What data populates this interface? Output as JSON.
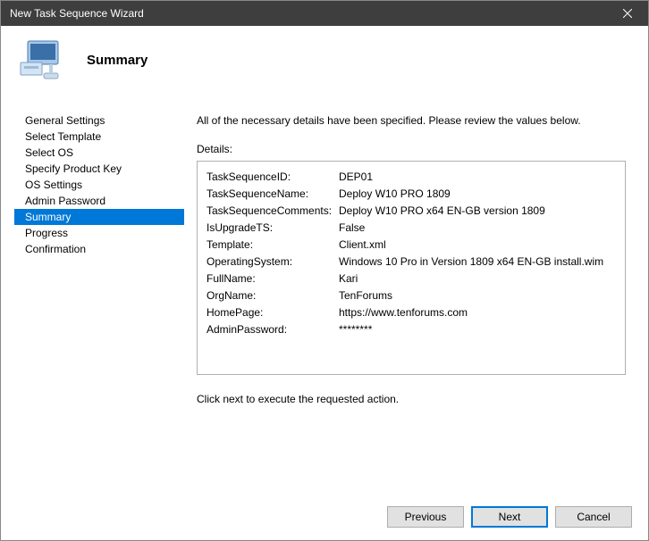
{
  "titlebar": {
    "title": "New Task Sequence Wizard"
  },
  "header": {
    "title": "Summary"
  },
  "sidebar": {
    "items": [
      {
        "label": "General Settings",
        "selected": false
      },
      {
        "label": "Select Template",
        "selected": false
      },
      {
        "label": "Select OS",
        "selected": false
      },
      {
        "label": "Specify Product Key",
        "selected": false
      },
      {
        "label": "OS Settings",
        "selected": false
      },
      {
        "label": "Admin Password",
        "selected": false
      },
      {
        "label": "Summary",
        "selected": true
      },
      {
        "label": "Progress",
        "selected": false
      },
      {
        "label": "Confirmation",
        "selected": false
      }
    ]
  },
  "content": {
    "instruction": "All of the necessary details have been specified.  Please review the values below.",
    "details_label": "Details:",
    "details": [
      {
        "key": "TaskSequenceID:",
        "val": "DEP01"
      },
      {
        "key": "TaskSequenceName:",
        "val": "Deploy W10 PRO 1809"
      },
      {
        "key": "TaskSequenceComments:",
        "val": "Deploy W10 PRO x64 EN-GB version 1809"
      },
      {
        "key": "IsUpgradeTS:",
        "val": "False"
      },
      {
        "key": "Template:",
        "val": "Client.xml"
      },
      {
        "key": "OperatingSystem:",
        "val": "Windows 10 Pro in Version 1809 x64 EN-GB install.wim"
      },
      {
        "key": "FullName:",
        "val": "Kari"
      },
      {
        "key": "OrgName:",
        "val": "TenForums"
      },
      {
        "key": "HomePage:",
        "val": "https://www.tenforums.com"
      },
      {
        "key": "AdminPassword:",
        "val": "********"
      }
    ],
    "footer_note": "Click next to execute the requested action."
  },
  "buttons": {
    "previous": "Previous",
    "next": "Next",
    "cancel": "Cancel"
  }
}
